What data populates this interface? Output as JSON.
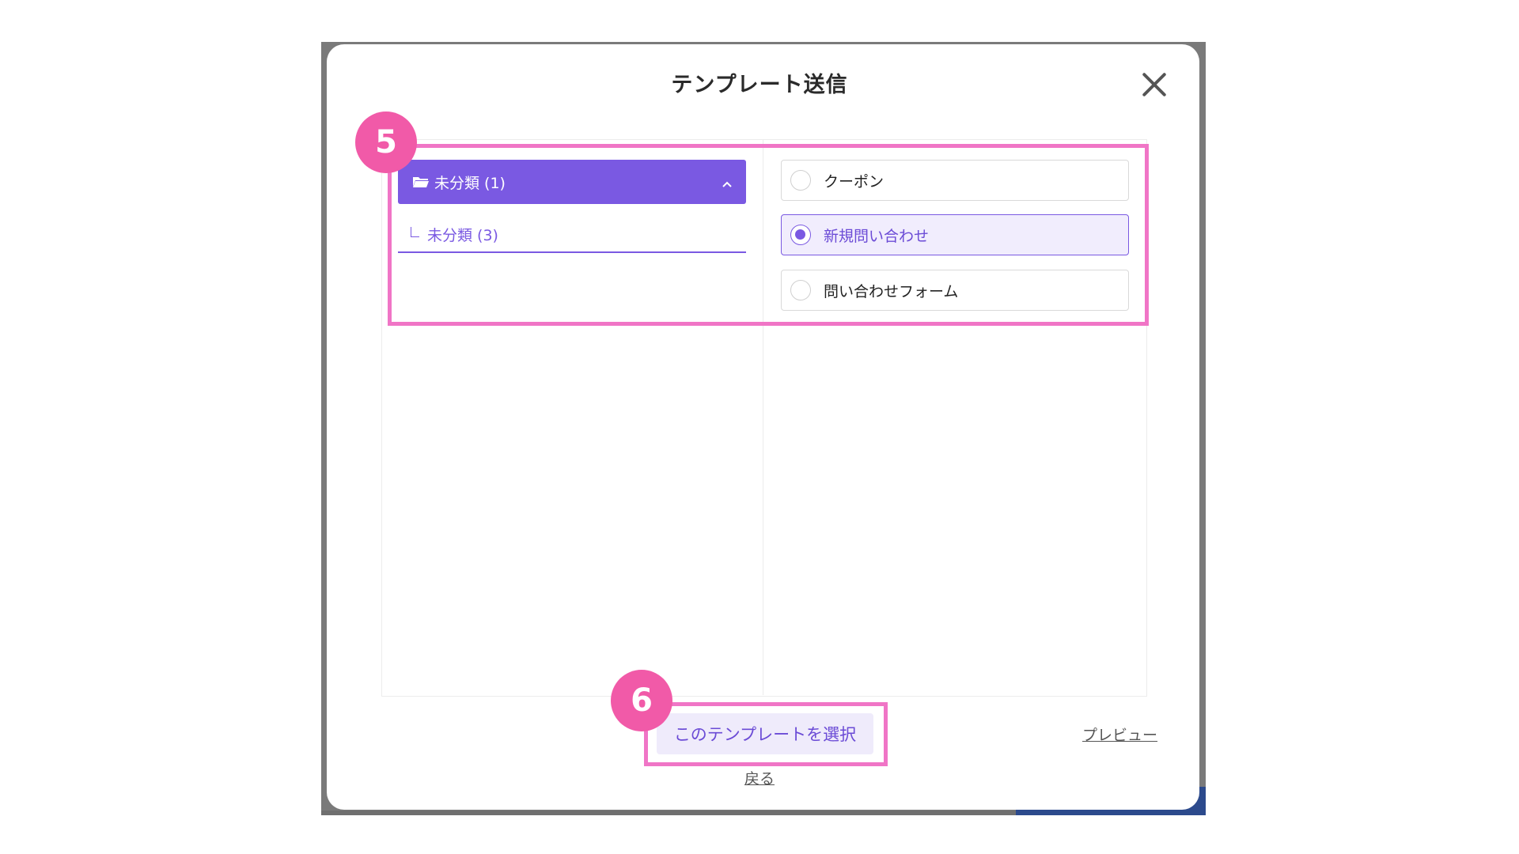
{
  "modal": {
    "title": "テンプレート送信",
    "close_icon": "close-icon"
  },
  "folders": {
    "header_label": "未分類 (1)",
    "header_icon": "folder-open-icon",
    "toggle_icon": "chevron-up-icon",
    "sub_label": "未分類 (3)"
  },
  "templates": [
    {
      "label": "クーポン",
      "selected": false
    },
    {
      "label": "新規問い合わせ",
      "selected": true
    },
    {
      "label": "問い合わせフォーム",
      "selected": false
    }
  ],
  "actions": {
    "select_label": "このテンプレートを選択",
    "preview_label": "プレビュー",
    "back_label": "戻る"
  },
  "annotations": {
    "step_a": "5",
    "step_b": "6"
  },
  "colors": {
    "accent": "#7a59e2",
    "highlight": "#f075c6",
    "badge": "#f15aa8"
  }
}
